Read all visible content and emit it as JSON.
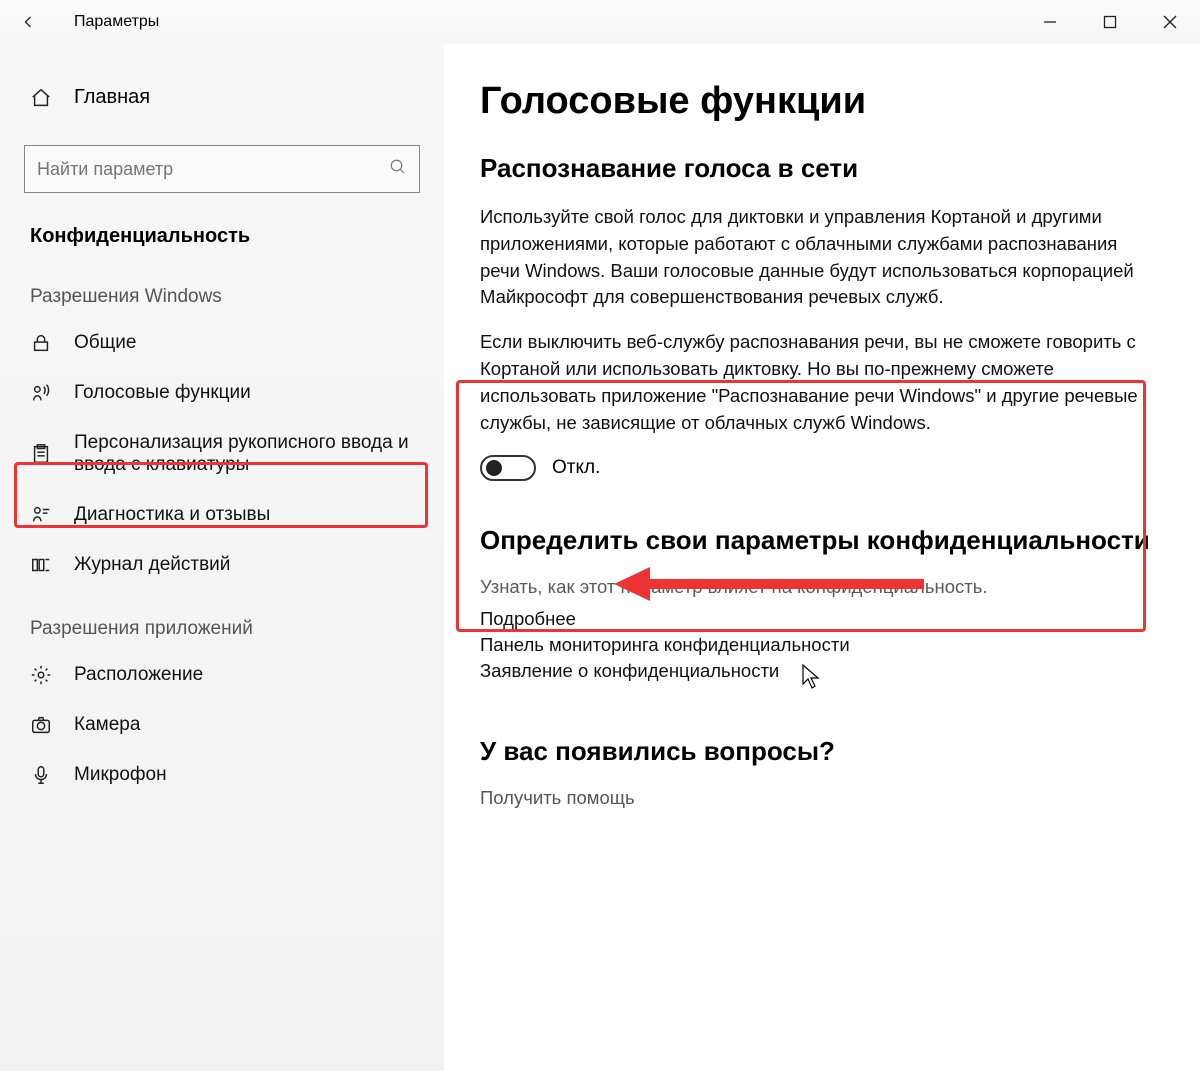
{
  "titlebar": {
    "app": "Параметры"
  },
  "sidebar": {
    "home": "Главная",
    "search_placeholder": "Найти параметр",
    "category": "Конфиденциальность",
    "group1": "Разрешения Windows",
    "items1": [
      "Общие",
      "Голосовые функции",
      "Персонализация рукописного ввода и ввода с клавиатуры",
      "Диагностика и отзывы",
      "Журнал действий"
    ],
    "group2": "Разрешения приложений",
    "items2": [
      "Расположение",
      "Камера",
      "Микрофон"
    ]
  },
  "main": {
    "title": "Голосовые функции",
    "section1": "Распознавание голоса в сети",
    "para1": "Используйте свой голос для диктовки и управления Кортаной и другими приложениями, которые работают с облачными службами распознавания речи Windows. Ваши голосовые данные будут использоваться корпорацией Майкрософт для совершенствования речевых служб.",
    "para2": "Если выключить веб-службу распознавания речи, вы не сможете говорить с Кортаной или использовать диктовку. Но вы по-прежнему сможете использовать приложение \"Распознавание речи Windows\" и другие речевые службы, не зависящие от облачных служб Windows.",
    "toggle_label": "Откл.",
    "section2": "Определить свои параметры конфиденциальности",
    "section2_sub": "Узнать, как этот параметр влияет на конфиденциальность.",
    "links": [
      "Подробнее",
      "Панель мониторинга конфиденциальности",
      "Заявление о конфиденциальности"
    ],
    "section3": "У вас появились вопросы?",
    "help_link": "Получить помощь"
  }
}
